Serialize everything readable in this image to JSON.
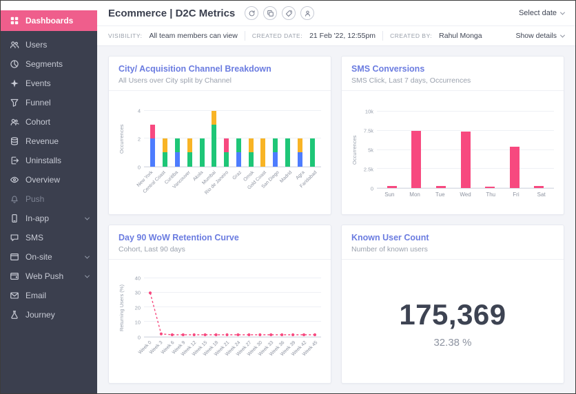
{
  "sidebar": {
    "items": [
      {
        "label": "Dashboards",
        "icon": "dashboards",
        "active": true
      },
      {
        "label": "Users",
        "icon": "users"
      },
      {
        "label": "Segments",
        "icon": "segments"
      },
      {
        "label": "Events",
        "icon": "events"
      },
      {
        "label": "Funnel",
        "icon": "funnel"
      },
      {
        "label": "Cohort",
        "icon": "cohort"
      },
      {
        "label": "Revenue",
        "icon": "revenue"
      },
      {
        "label": "Uninstalls",
        "icon": "uninstalls"
      },
      {
        "label": "Overview",
        "icon": "overview"
      },
      {
        "label": "Push",
        "icon": "push",
        "muted": true
      },
      {
        "label": "In-app",
        "icon": "inapp",
        "expandable": true
      },
      {
        "label": "SMS",
        "icon": "sms"
      },
      {
        "label": "On-site",
        "icon": "onsite",
        "expandable": true
      },
      {
        "label": "Web Push",
        "icon": "webpush",
        "expandable": true
      },
      {
        "label": "Email",
        "icon": "email"
      },
      {
        "label": "Journey",
        "icon": "journey"
      }
    ]
  },
  "header": {
    "title": "Ecommerce | D2C Metrics",
    "actions": [
      {
        "icon": "refresh"
      },
      {
        "icon": "copy"
      },
      {
        "icon": "tag"
      },
      {
        "icon": "share"
      }
    ],
    "select_date_label": "Select date"
  },
  "meta": {
    "visibility_label": "Visibility:",
    "visibility_value": "All team members can view",
    "created_date_label": "Created date:",
    "created_date_value": "21 Feb '22, 12:55pm",
    "created_by_label": "Created by:",
    "created_by_value": "Rahul Monga",
    "show_details_label": "Show details"
  },
  "chart_data": [
    {
      "type": "bar",
      "stacked": true,
      "title": "City/ Acquisition Channel Breakdown",
      "subtitle": "All Users over City split by Channel",
      "ylabel": "Occurrences",
      "ylim": [
        0,
        4
      ],
      "yticks": [
        0,
        2,
        4
      ],
      "ytick_labels": [
        "0",
        "2",
        "4"
      ],
      "rotate_labels": true,
      "categories": [
        "New York",
        "Central Coast",
        "Curitiba",
        "Vancouver",
        "Akola",
        "Mumbai",
        "Rio de Janeiro",
        "Graz",
        "Omsk",
        "Gold Coast",
        "San Diego",
        "Madrid",
        "Agra",
        "Faridabad"
      ],
      "series": [
        {
          "name": "series-blue",
          "color": "#4d7cfe",
          "values": [
            2,
            0,
            1,
            0,
            0,
            0,
            0,
            1,
            0,
            0,
            1,
            0,
            1,
            0
          ]
        },
        {
          "name": "series-green",
          "color": "#1ec677",
          "values": [
            0,
            1,
            1,
            1,
            2,
            3,
            1,
            1,
            1,
            0,
            1,
            2,
            0,
            2
          ]
        },
        {
          "name": "series-yellow",
          "color": "#f8b425",
          "values": [
            0,
            1,
            0,
            1,
            0,
            1,
            0,
            0,
            1,
            2,
            0,
            0,
            1,
            0
          ]
        },
        {
          "name": "series-pink",
          "color": "#f7497f",
          "values": [
            1,
            0,
            0,
            0,
            0,
            0,
            1,
            0,
            0,
            0,
            0,
            0,
            0,
            0
          ]
        }
      ]
    },
    {
      "type": "bar",
      "title": "SMS Conversions",
      "subtitle": "SMS Click, Last 7 days, Occurrences",
      "ylabel": "Occurrences",
      "ylim": [
        0,
        10000
      ],
      "yticks": [
        0,
        2500,
        5000,
        7500,
        10000
      ],
      "ytick_labels": [
        "0",
        "2.5k",
        "5k",
        "7.5k",
        "10k"
      ],
      "rotate_labels": false,
      "categories": [
        "Sun",
        "Mon",
        "Tue",
        "Wed",
        "Thu",
        "Fri",
        "Sat"
      ],
      "values": [
        300,
        7500,
        300,
        7400,
        100,
        5400,
        300
      ],
      "bar_color": "#f7497f"
    },
    {
      "type": "line",
      "title": "Day 90 WoW Retention Curve",
      "subtitle": "Cohort, Last 90 days",
      "ylabel": "Returning Users (%)",
      "ylim": [
        0,
        40
      ],
      "yticks": [
        0,
        10,
        20,
        30,
        40
      ],
      "ytick_labels": [
        "0",
        "10",
        "20",
        "30",
        "40"
      ],
      "rotate_labels": true,
      "categories": [
        "Week 0",
        "Week 3",
        "Week 6",
        "Week 9",
        "Week 12",
        "Week 15",
        "Week 18",
        "Week 21",
        "Week 24",
        "Week 27",
        "Week 30",
        "Week 33",
        "Week 36",
        "Week 39",
        "Week 42",
        "Week 45"
      ],
      "values": [
        30,
        2,
        1,
        1,
        1,
        1,
        1,
        1,
        1,
        1,
        1,
        1,
        1,
        1,
        1,
        1
      ],
      "line_color": "#f7497f",
      "line_style": "dashed"
    },
    {
      "type": "kpi",
      "title": "Known User Count",
      "subtitle": "Number of known users",
      "value": "175,369",
      "sub_value": "32.38 %"
    }
  ]
}
